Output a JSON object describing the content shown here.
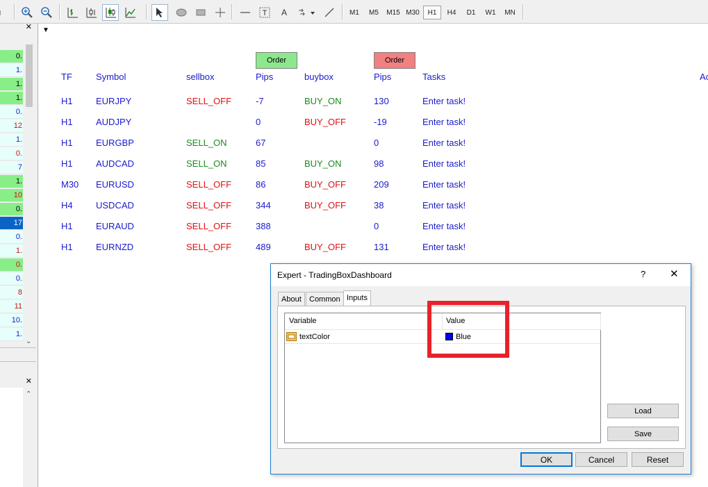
{
  "toolbar": {
    "timeframes": [
      "M1",
      "M5",
      "M15",
      "M30",
      "H1",
      "H4",
      "D1",
      "W1",
      "MN"
    ],
    "active_timeframe": "H1"
  },
  "left_panel": {
    "cells": [
      {
        "text": "0.",
        "bg": "#88ee88",
        "color": "#000"
      },
      {
        "text": "1.",
        "bg": "#e6fffa",
        "color": "#1a1acc"
      },
      {
        "text": "1.",
        "bg": "#88ee88",
        "color": "#000"
      },
      {
        "text": "1.",
        "bg": "#88ee88",
        "color": "#000"
      },
      {
        "text": "0.",
        "bg": "#e6fffa",
        "color": "#1a1acc"
      },
      {
        "text": "12",
        "bg": "#e6fffa",
        "color": "#d01010"
      },
      {
        "text": "1.",
        "bg": "#e6fffa",
        "color": "#1a1acc"
      },
      {
        "text": "0.",
        "bg": "#e6fffa",
        "color": "#d01010"
      },
      {
        "text": "7",
        "bg": "#e6fffa",
        "color": "#1a1acc"
      },
      {
        "text": "1.",
        "bg": "#88ee88",
        "color": "#000"
      },
      {
        "text": "10",
        "bg": "#88ee88",
        "color": "#d01010"
      },
      {
        "text": "0.",
        "bg": "#88ee88",
        "color": "#000"
      },
      {
        "text": "17",
        "bg": "#0a64c8",
        "color": "#fff"
      },
      {
        "text": "0.",
        "bg": "#e6fffa",
        "color": "#1a1acc"
      },
      {
        "text": "1.",
        "bg": "#e6fffa",
        "color": "#d01010"
      },
      {
        "text": "0.",
        "bg": "#88ee88",
        "color": "#d01010"
      },
      {
        "text": "0.",
        "bg": "#e6fffa",
        "color": "#1a1acc"
      },
      {
        "text": "8",
        "bg": "#e6fffa",
        "color": "#d01010"
      },
      {
        "text": "11",
        "bg": "#e6fffa",
        "color": "#d01010"
      },
      {
        "text": "10.",
        "bg": "#e6fffa",
        "color": "#1a1acc"
      },
      {
        "text": "1.",
        "bg": "#e6fffa",
        "color": "#1a1acc"
      }
    ]
  },
  "dashboard": {
    "order_label": "Order",
    "headers": {
      "tf": "TF",
      "symbol": "Symbol",
      "sellbox": "sellbox",
      "pips1": "Pips",
      "buybox": "buybox",
      "pips2": "Pips",
      "tasks": "Tasks",
      "extra": "Ac"
    },
    "rows": [
      {
        "tf": "H1",
        "symbol": "EURJPY",
        "sell": "SELL_OFF",
        "sell_color": "red",
        "pips1": "-7",
        "buy": "BUY_ON",
        "buy_color": "green",
        "pips2": "130",
        "task": "Enter task!"
      },
      {
        "tf": "H1",
        "symbol": "AUDJPY",
        "sell": "",
        "sell_color": "red",
        "pips1": "0",
        "buy": "BUY_OFF",
        "buy_color": "red",
        "pips2": "-19",
        "task": "Enter task!"
      },
      {
        "tf": "H1",
        "symbol": "EURGBP",
        "sell": "SELL_ON",
        "sell_color": "green",
        "pips1": "67",
        "buy": "",
        "buy_color": "red",
        "pips2": "0",
        "task": "Enter task!"
      },
      {
        "tf": "H1",
        "symbol": "AUDCAD",
        "sell": "SELL_ON",
        "sell_color": "green",
        "pips1": "85",
        "buy": "BUY_ON",
        "buy_color": "green",
        "pips2": "98",
        "task": "Enter task!"
      },
      {
        "tf": "M30",
        "symbol": "EURUSD",
        "sell": "SELL_OFF",
        "sell_color": "red",
        "pips1": "86",
        "buy": "BUY_OFF",
        "buy_color": "red",
        "pips2": "209",
        "task": "Enter task!"
      },
      {
        "tf": "H4",
        "symbol": "USDCAD",
        "sell": "SELL_OFF",
        "sell_color": "red",
        "pips1": "344",
        "buy": "BUY_OFF",
        "buy_color": "red",
        "pips2": "38",
        "task": "Enter task!"
      },
      {
        "tf": "H1",
        "symbol": "EURAUD",
        "sell": "SELL_OFF",
        "sell_color": "red",
        "pips1": "388",
        "buy": "",
        "buy_color": "red",
        "pips2": "0",
        "task": "Enter task!"
      },
      {
        "tf": "H1",
        "symbol": "EURNZD",
        "sell": "SELL_OFF",
        "sell_color": "red",
        "pips1": "489",
        "buy": "BUY_OFF",
        "buy_color": "red",
        "pips2": "131",
        "task": "Enter task!"
      }
    ]
  },
  "dialog": {
    "title": "Expert - TradingBoxDashboard",
    "help": "?",
    "close": "✕",
    "tabs": [
      "About",
      "Common",
      "Inputs"
    ],
    "active_tab": "Inputs",
    "grid": {
      "col_variable": "Variable",
      "col_value": "Value",
      "rows": [
        {
          "variable": "textColor",
          "value": "Blue",
          "swatch": "#0000ff"
        }
      ]
    },
    "load": "Load",
    "save": "Save",
    "ok": "OK",
    "cancel": "Cancel",
    "reset": "Reset"
  },
  "colors": {
    "highlight": "#e8222b",
    "blue_text": "#1a1acc",
    "red_text": "#e01010",
    "green_text": "#1a8a1a"
  }
}
